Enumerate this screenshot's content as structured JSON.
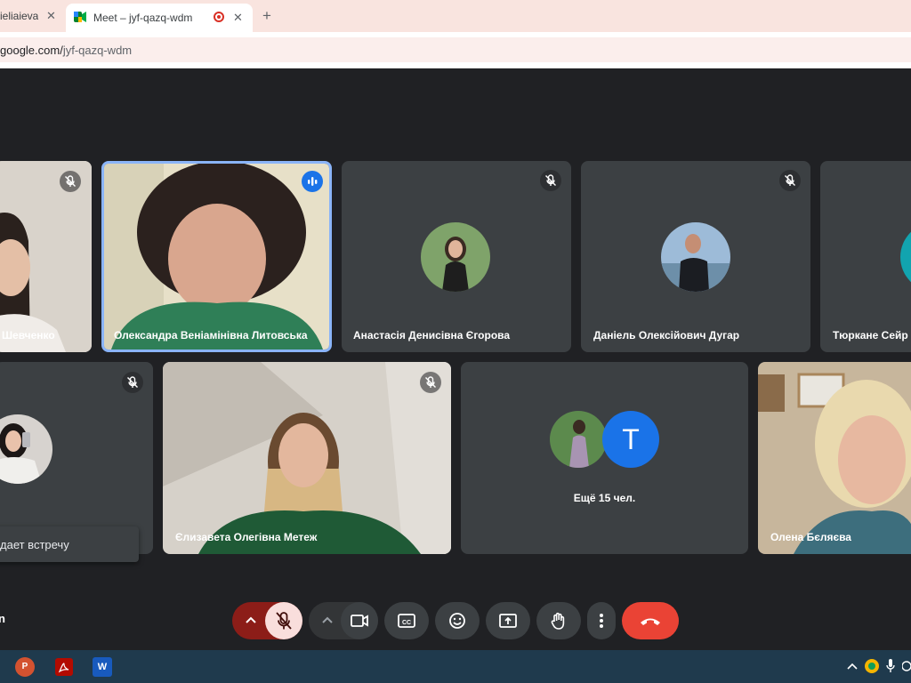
{
  "browser": {
    "prev_tab_title": "ieliaieva",
    "active_tab_title": "Meet – jyf-qazq-wdm",
    "url_host": "google.com/",
    "url_path": "jyf-qazq-wdm"
  },
  "participants": [
    {
      "name": "Шевченко",
      "muted": true
    },
    {
      "name": "Олександра Веніамінівна Литовська",
      "speaking": true
    },
    {
      "name": "Анастасія Денисівна Єгорова",
      "muted": true
    },
    {
      "name": "Даніель Олексійович Дугар",
      "muted": true
    },
    {
      "name": "Тюркане Сейр",
      "muted": false
    },
    {
      "name": "",
      "muted": true
    },
    {
      "name": "Єлизавета Олегівна Метеж",
      "muted": true
    },
    {
      "name": "Олена Бєляєва",
      "muted": false
    }
  ],
  "others": {
    "avatar_letter": "T",
    "label": "Ещё 15 чел."
  },
  "toast": {
    "text": "дает встречу"
  },
  "bottom_left_text": "n",
  "colors": {
    "accent": "#8ab4f8",
    "end_call": "#ea4335",
    "mic_off": "#f9dedc",
    "avatar_blue": "#1a73e8"
  }
}
